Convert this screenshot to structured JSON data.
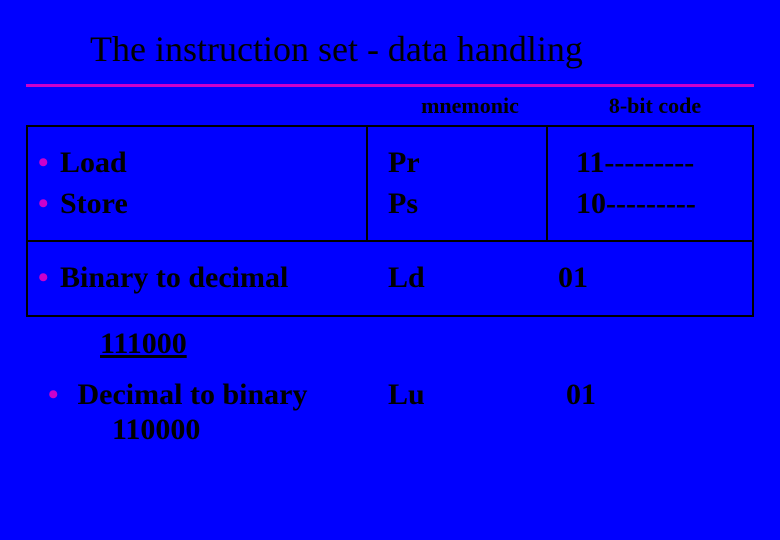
{
  "title": "The instruction set  -  data handling",
  "headers": {
    "mnemonic": "mnemonic",
    "code": "8-bit code"
  },
  "rows": [
    {
      "desc_lines": [
        "Load",
        "Store"
      ],
      "mnemonic_lines": [
        "Pr",
        "Ps"
      ],
      "code_lines": [
        "11---------",
        "10---------"
      ]
    },
    {
      "desc_lines": [
        "Binary to decimal"
      ],
      "mnemonic_lines": [
        "Ld"
      ],
      "code_lines": [
        "01"
      ]
    },
    {
      "desc_lines": [
        "Decimal to binary"
      ],
      "mnemonic_lines": [
        "Lu"
      ],
      "code_lines": [
        "01"
      ]
    }
  ],
  "inter_value": "111000",
  "row3_sub": "110000"
}
